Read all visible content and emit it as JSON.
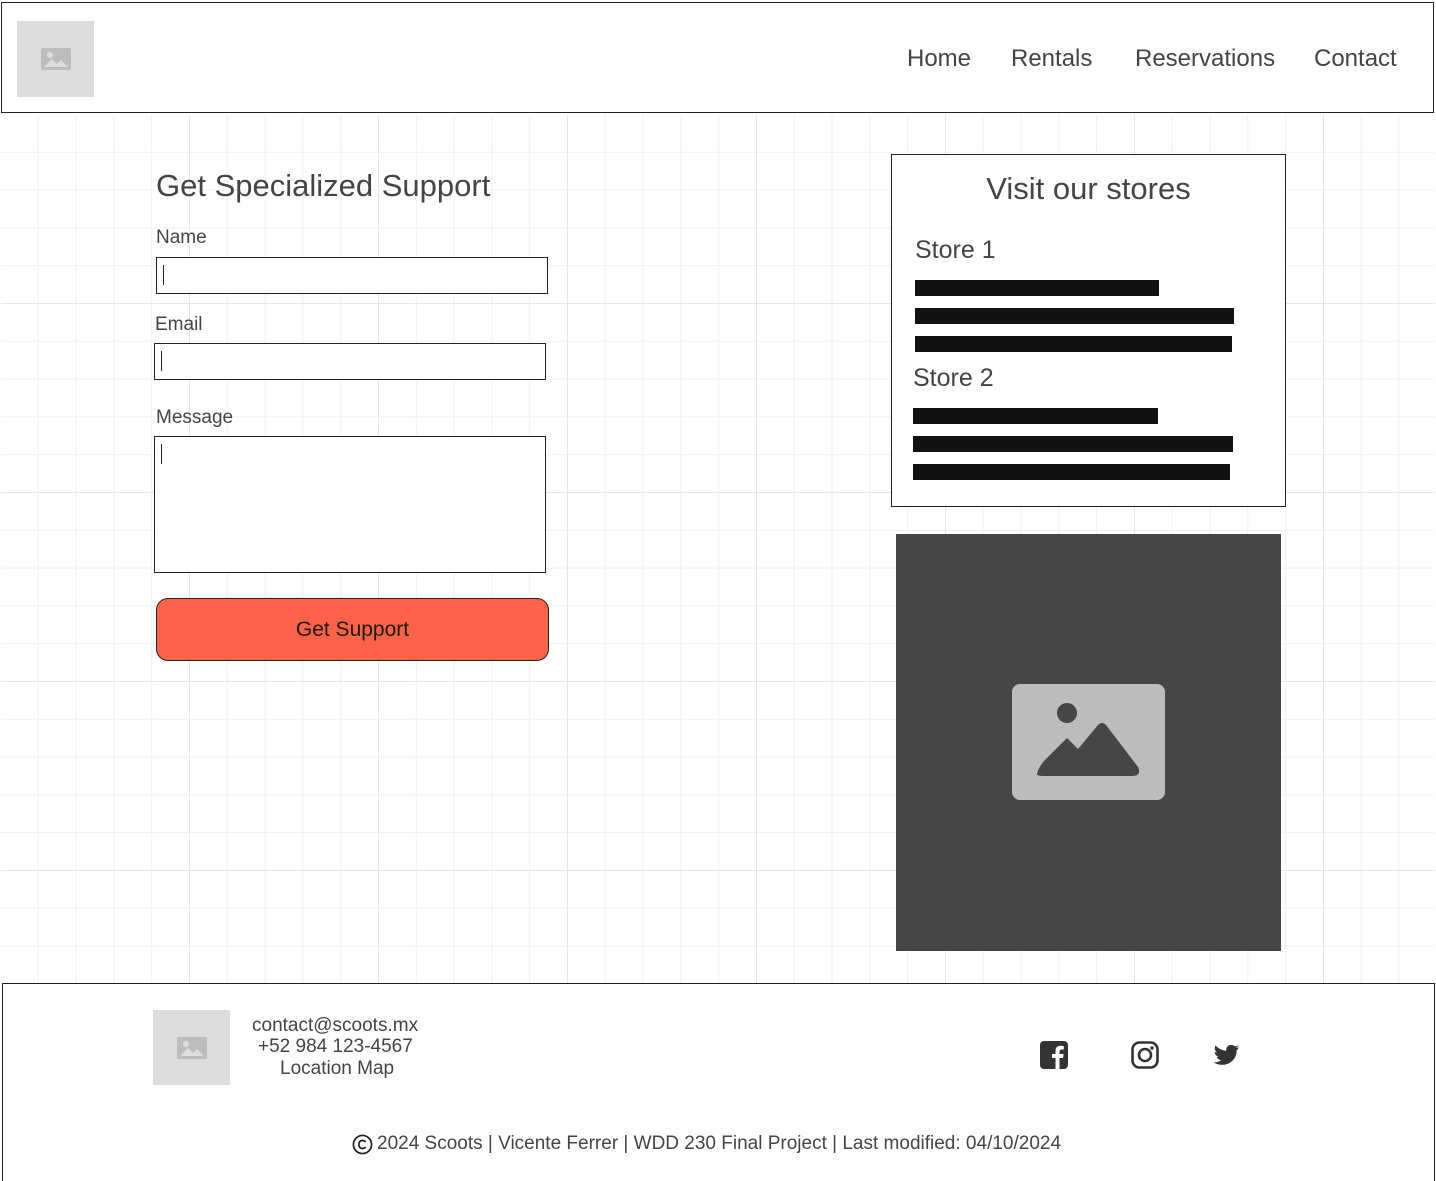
{
  "header": {
    "logo_icon": "image-placeholder-icon",
    "nav": [
      {
        "label": "Home"
      },
      {
        "label": "Rentals"
      },
      {
        "label": "Reservations"
      },
      {
        "label": "Contact"
      }
    ]
  },
  "form": {
    "title": "Get Specialized Support",
    "name_label": "Name",
    "name_value": "",
    "email_label": "Email",
    "email_value": "",
    "message_label": "Message",
    "message_value": "",
    "submit_label": "Get Support"
  },
  "stores": {
    "title": "Visit our stores",
    "items": [
      {
        "name": "Store 1"
      },
      {
        "name": "Store 2"
      }
    ]
  },
  "map": {
    "icon": "image-placeholder-icon"
  },
  "footer": {
    "logo_icon": "image-placeholder-icon",
    "email": "contact@scoots.mx",
    "phone": "+52 984 123-4567",
    "map_link": "Location Map",
    "social": [
      "facebook-icon",
      "instagram-icon",
      "twitter-icon"
    ],
    "copyright": "2024 Scoots | Vicente Ferrer | WDD 230 Final Project |  Last modified: 04/10/2024"
  },
  "colors": {
    "accent": "#ff6347",
    "text": "#444444",
    "map_bg": "#464646",
    "placeholder_bg": "#dddddd"
  }
}
